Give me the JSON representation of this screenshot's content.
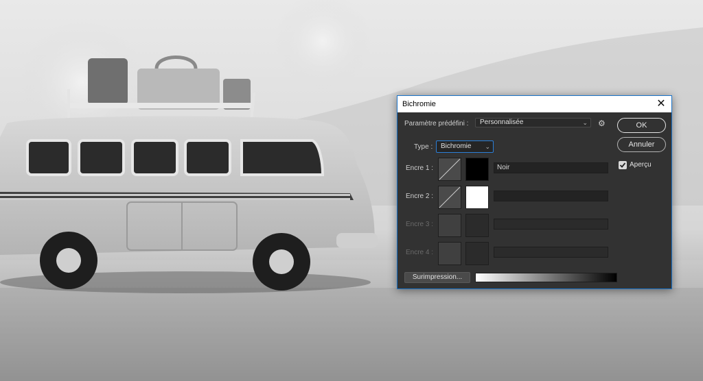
{
  "dialog": {
    "title": "Bichromie",
    "preset_label": "Paramètre prédéfini :",
    "preset_value": "Personnalisée",
    "type_label": "Type :",
    "type_value": "Bichromie",
    "inks": [
      {
        "label": "Encre 1 :",
        "name": "Noir",
        "color": "#000000",
        "enabled": true
      },
      {
        "label": "Encre 2 :",
        "name": "",
        "color": "#ffffff",
        "enabled": true
      },
      {
        "label": "Encre 3 :",
        "name": "",
        "color": "#2b2b2b",
        "enabled": false
      },
      {
        "label": "Encre 4 :",
        "name": "",
        "color": "#2b2b2b",
        "enabled": false
      }
    ],
    "overprint_label": "Surimpression...",
    "ok_label": "OK",
    "cancel_label": "Annuler",
    "preview_label": "Aperçu",
    "preview_checked": true
  },
  "colors": {
    "dialog_bg": "#323232",
    "accent": "#1a73c9"
  },
  "icons": {
    "close": "close-icon",
    "gear": "gear-icon",
    "chevron": "chevron-down-icon",
    "check": "checkmark-icon"
  }
}
